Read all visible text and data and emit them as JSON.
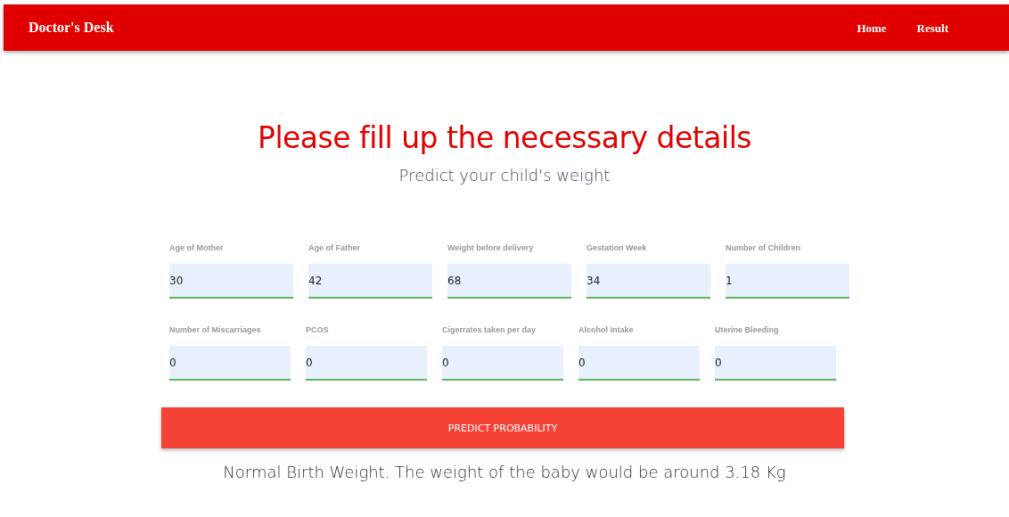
{
  "navbar": {
    "brand": "Doctor's Desk",
    "links": [
      "Home",
      "Result"
    ]
  },
  "heading": {
    "title": "Please fill up the necessary details",
    "subtitle": "Predict your child's weight"
  },
  "form": {
    "rows": [
      [
        {
          "label": "Age of Mother",
          "value": "30"
        },
        {
          "label": "Age of Father",
          "value": "42"
        },
        {
          "label": "Weight before delivery",
          "value": "68"
        },
        {
          "label": "Gestation Week",
          "value": "34"
        },
        {
          "label": "Number of Children",
          "value": "1"
        }
      ],
      [
        {
          "label": "Number of Miscarriages",
          "value": "0"
        },
        {
          "label": "PCOS",
          "value": "0"
        },
        {
          "label": "Cigerrates taken per day",
          "value": "0"
        },
        {
          "label": "Alcohol Intake",
          "value": "0"
        },
        {
          "label": "Uterine Bleeding",
          "value": "0"
        }
      ]
    ],
    "button": "PREDICT PROBABILITY"
  },
  "result": "Normal Birth Weight. The weight of the baby would be around 3.18 Kg"
}
